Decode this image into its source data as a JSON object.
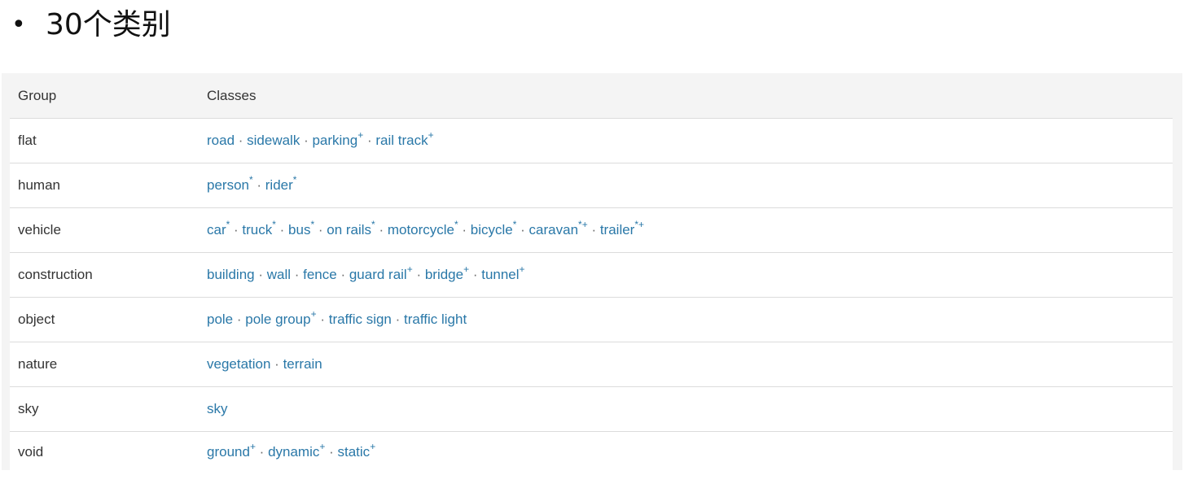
{
  "heading": {
    "bullet": "•",
    "text": "30个类别"
  },
  "table": {
    "headers": [
      "Group",
      "Classes"
    ],
    "separator": " · ",
    "rows": [
      {
        "group": "flat",
        "classes": [
          {
            "name": "road",
            "mark": ""
          },
          {
            "name": "sidewalk",
            "mark": ""
          },
          {
            "name": "parking",
            "mark": "+"
          },
          {
            "name": "rail track",
            "mark": "+"
          }
        ]
      },
      {
        "group": "human",
        "classes": [
          {
            "name": "person",
            "mark": "*"
          },
          {
            "name": "rider",
            "mark": "*"
          }
        ]
      },
      {
        "group": "vehicle",
        "classes": [
          {
            "name": "car",
            "mark": "*"
          },
          {
            "name": "truck",
            "mark": "*"
          },
          {
            "name": "bus",
            "mark": "*"
          },
          {
            "name": "on rails",
            "mark": "*"
          },
          {
            "name": "motorcycle",
            "mark": "*"
          },
          {
            "name": "bicycle",
            "mark": "*"
          },
          {
            "name": "caravan",
            "mark": "*+"
          },
          {
            "name": "trailer",
            "mark": "*+"
          }
        ]
      },
      {
        "group": "construction",
        "classes": [
          {
            "name": "building",
            "mark": ""
          },
          {
            "name": "wall",
            "mark": ""
          },
          {
            "name": "fence",
            "mark": ""
          },
          {
            "name": "guard rail",
            "mark": "+"
          },
          {
            "name": "bridge",
            "mark": "+"
          },
          {
            "name": "tunnel",
            "mark": "+"
          }
        ]
      },
      {
        "group": "object",
        "classes": [
          {
            "name": "pole",
            "mark": ""
          },
          {
            "name": "pole group",
            "mark": "+"
          },
          {
            "name": "traffic sign",
            "mark": ""
          },
          {
            "name": "traffic light",
            "mark": ""
          }
        ]
      },
      {
        "group": "nature",
        "classes": [
          {
            "name": "vegetation",
            "mark": ""
          },
          {
            "name": "terrain",
            "mark": ""
          }
        ]
      },
      {
        "group": "sky",
        "classes": [
          {
            "name": "sky",
            "mark": ""
          }
        ]
      },
      {
        "group": "void",
        "classes": [
          {
            "name": "ground",
            "mark": "+"
          },
          {
            "name": "dynamic",
            "mark": "+"
          },
          {
            "name": "static",
            "mark": "+"
          }
        ]
      }
    ]
  },
  "colors": {
    "link": "#2a78a8",
    "text": "#333333",
    "row_bg": "#ffffff",
    "table_bg": "#f4f4f4",
    "border": "#dcdcdc"
  }
}
